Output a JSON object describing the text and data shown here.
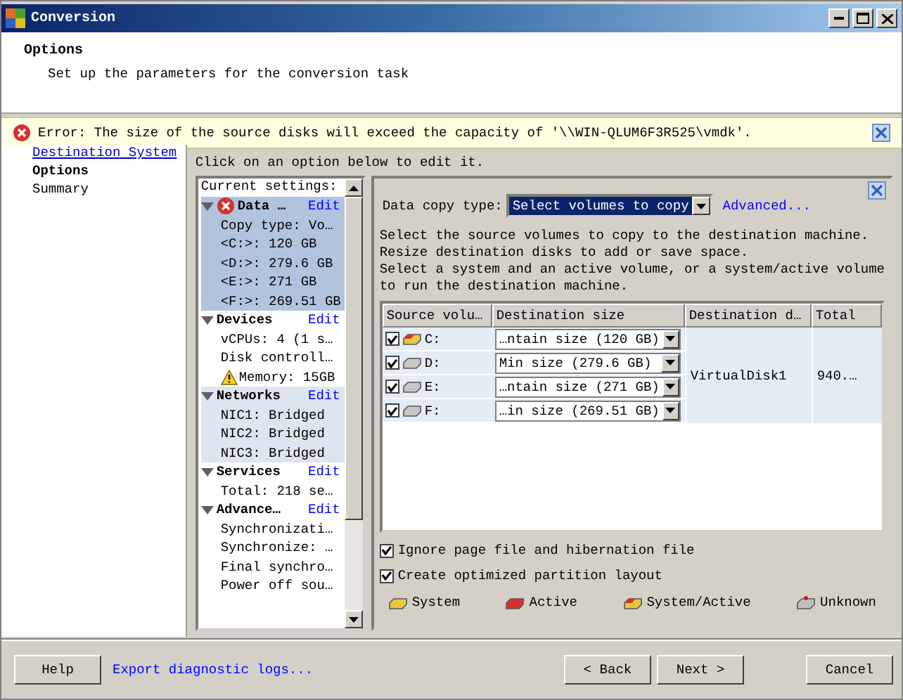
{
  "window": {
    "title": "Conversion"
  },
  "header": {
    "title": "Options",
    "subtitle": "Set up the parameters for the conversion task"
  },
  "error": {
    "text": "Error: The size of the source disks will exceed the capacity of '\\\\WIN-QLUM6F3R525\\vmdk'."
  },
  "nav": [
    {
      "label": "Destination System",
      "kind": "link",
      "selected": false
    },
    {
      "label": "Options",
      "kind": "plain",
      "selected": true
    },
    {
      "label": "Summary",
      "kind": "plain",
      "selected": false
    }
  ],
  "instruction": "Click on an option below to edit it.",
  "settings": {
    "heading": "Current settings:",
    "sections": [
      {
        "title": "Data …",
        "edit": "Edit",
        "kind": "error",
        "selected": true,
        "hovered": false,
        "items": [
          {
            "text": "Copy type: Vo…",
            "kind": "plain"
          },
          {
            "text": "<C:>: 120 GB",
            "kind": "plain"
          },
          {
            "text": "<D:>: 279.6 GB",
            "kind": "plain"
          },
          {
            "text": "<E:>: 271 GB",
            "kind": "plain"
          },
          {
            "text": "<F:>: 269.51 GB",
            "kind": "plain"
          }
        ]
      },
      {
        "title": "Devices",
        "edit": "Edit",
        "kind": "plain",
        "selected": false,
        "hovered": false,
        "items": [
          {
            "text": "vCPUs: 4 (1 s…",
            "kind": "plain"
          },
          {
            "text": "Disk controll…",
            "kind": "plain"
          },
          {
            "text": "Memory: 15GB",
            "kind": "warning"
          }
        ]
      },
      {
        "title": "Networks",
        "edit": "Edit",
        "kind": "plain",
        "selected": false,
        "hovered": true,
        "items": [
          {
            "text": "NIC1: Bridged",
            "kind": "plain"
          },
          {
            "text": "NIC2: Bridged",
            "kind": "plain"
          },
          {
            "text": "NIC3: Bridged",
            "kind": "plain"
          }
        ]
      },
      {
        "title": "Services",
        "edit": "Edit",
        "kind": "plain",
        "selected": false,
        "hovered": false,
        "items": [
          {
            "text": "Total: 218 se…",
            "kind": "plain"
          }
        ]
      },
      {
        "title": "Advance…",
        "edit": "Edit",
        "kind": "plain",
        "selected": false,
        "hovered": false,
        "items": [
          {
            "text": "Synchronizati…",
            "kind": "plain"
          },
          {
            "text": "Synchronize: …",
            "kind": "plain"
          },
          {
            "text": "Final synchro…",
            "kind": "plain"
          },
          {
            "text": "Power off sou…",
            "kind": "plain"
          }
        ]
      }
    ]
  },
  "detail": {
    "copy_type_label": "Data copy type:",
    "copy_type_value": "Select volumes to copy",
    "advanced_link": "Advanced...",
    "description": [
      "Select the source volumes to copy to the destination machine.",
      "Resize destination disks to add or save space.",
      "Select a system and an active volume, or a system/active volume",
      "to run the destination machine."
    ],
    "table": {
      "columns": [
        "Source volu…",
        "Destination size",
        "Destination d…",
        "Total"
      ],
      "rows": [
        {
          "checked": true,
          "kind": "system_active",
          "volume": "C:",
          "size": "…ntain size (120 GB)",
          "selected": true
        },
        {
          "checked": true,
          "kind": "basic",
          "volume": "D:",
          "size": "Min size (279.6 GB)",
          "selected": true
        },
        {
          "checked": true,
          "kind": "basic",
          "volume": "E:",
          "size": "…ntain size (271 GB)",
          "selected": true
        },
        {
          "checked": true,
          "kind": "basic",
          "volume": "F:",
          "size": "…in size (269.51 GB)",
          "selected": true
        }
      ],
      "destination_disk": "VirtualDisk1",
      "total": "940.…"
    },
    "options": [
      {
        "label": "Ignore page file and hibernation file",
        "checked": true
      },
      {
        "label": "Create optimized partition layout",
        "checked": true
      }
    ],
    "legend": [
      {
        "kind": "system",
        "label": "System"
      },
      {
        "kind": "active",
        "label": "Active"
      },
      {
        "kind": "system_active",
        "label": "System/Active"
      },
      {
        "kind": "unknown",
        "label": "Unknown"
      }
    ]
  },
  "footer": {
    "help": "Help",
    "export_link": "Export diagnostic logs...",
    "back": "< Back",
    "next": "Next >",
    "cancel": "Cancel"
  }
}
